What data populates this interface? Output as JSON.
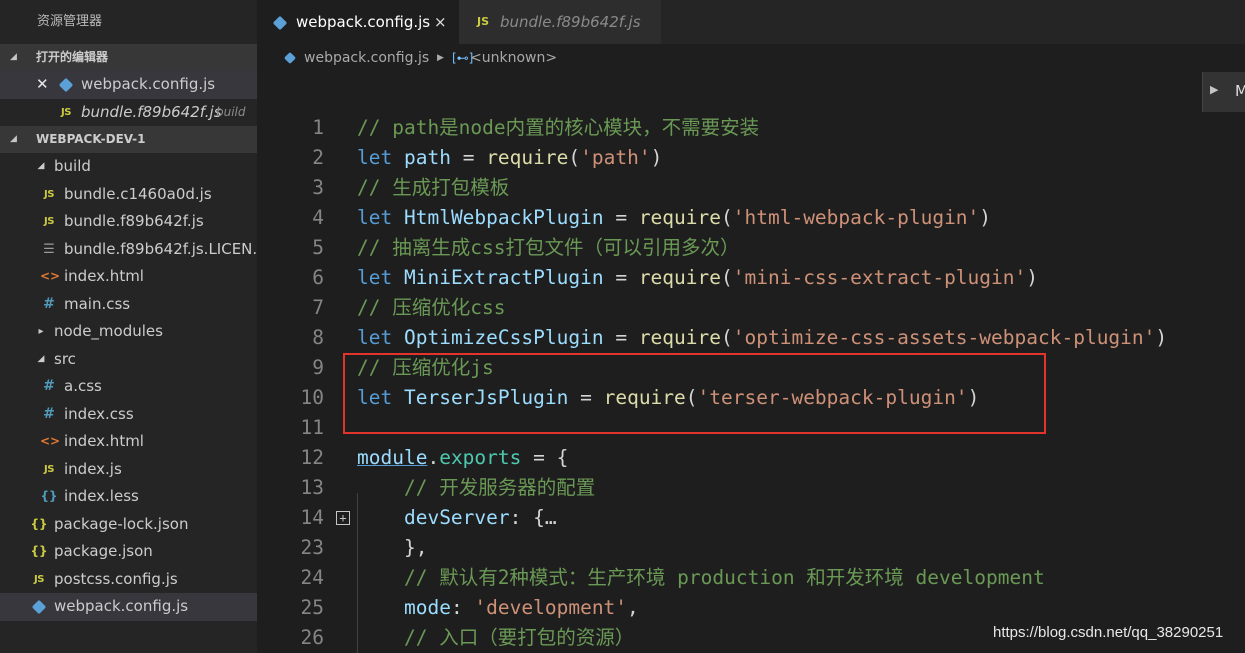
{
  "sidebar": {
    "title": "资源管理器",
    "open_editors": {
      "header": "打开的编辑器",
      "items": [
        {
          "label": "webpack.config.js",
          "icon": "webpack-cube-icon"
        },
        {
          "label": "bundle.f89b642f.js",
          "icon": "js-icon",
          "suffix": "build"
        }
      ]
    },
    "project": {
      "header": "WEBPACK-DEV-1",
      "tree": [
        {
          "label": "build",
          "type": "folder-open"
        },
        {
          "label": "bundle.c1460a0d.js",
          "icon": "JS"
        },
        {
          "label": "bundle.f89b642f.js",
          "icon": "JS"
        },
        {
          "label": "bundle.f89b642f.js.LICEN...",
          "icon": "≡"
        },
        {
          "label": "index.html",
          "icon": "<>"
        },
        {
          "label": "main.css",
          "icon": "#"
        },
        {
          "label": "node_modules",
          "type": "folder-closed"
        },
        {
          "label": "src",
          "type": "folder-open"
        },
        {
          "label": "a.css",
          "icon": "#"
        },
        {
          "label": "index.css",
          "icon": "#"
        },
        {
          "label": "index.html",
          "icon": "<>"
        },
        {
          "label": "index.js",
          "icon": "JS"
        },
        {
          "label": "index.less",
          "icon": "{}"
        },
        {
          "label": "package-lock.json",
          "icon": "{}"
        },
        {
          "label": "package.json",
          "icon": "{}"
        },
        {
          "label": "postcss.config.js",
          "icon": "JS"
        },
        {
          "label": "webpack.config.js",
          "icon": "webpack-cube-icon"
        }
      ]
    }
  },
  "tabs": [
    {
      "label": "webpack.config.js",
      "icon": "webpack-cube-icon",
      "close": "×"
    },
    {
      "label": "bundle.f89b642f.js",
      "icon": "JS"
    }
  ],
  "breadcrumb": {
    "file": "webpack.config.js",
    "symbol": "<unknown>"
  },
  "minimap_label": "M",
  "editor": {
    "lines": [
      {
        "num": "1",
        "text": "// path是node内置的核心模块，不需要安装"
      },
      {
        "num": "2",
        "text": "let path = require('path')"
      },
      {
        "num": "3",
        "text": "// 生成打包模板"
      },
      {
        "num": "4",
        "text": "let HtmlWebpackPlugin = require('html-webpack-plugin')"
      },
      {
        "num": "5",
        "text": "// 抽离生成css打包文件（可以引用多次）"
      },
      {
        "num": "6",
        "text": "let MiniExtractPlugin = require('mini-css-extract-plugin')"
      },
      {
        "num": "7",
        "text": "// 压缩优化css"
      },
      {
        "num": "8",
        "text": "let OptimizeCssPlugin = require('optimize-css-assets-webpack-plugin')"
      },
      {
        "num": "9",
        "text": "// 压缩优化js"
      },
      {
        "num": "10",
        "text": "let TerserJsPlugin = require('terser-webpack-plugin')"
      },
      {
        "num": "11",
        "text": ""
      },
      {
        "num": "12",
        "text": "module.exports = {"
      },
      {
        "num": "13",
        "text": "    // 开发服务器的配置"
      },
      {
        "num": "14",
        "text": "    devServer: {…"
      },
      {
        "num": "23",
        "text": "    },"
      },
      {
        "num": "24",
        "text": "    // 默认有2种模式：生产环境 production 和开发环境 development"
      },
      {
        "num": "25",
        "text": "    mode: 'development',"
      },
      {
        "num": "26",
        "text": "    // 入口（要打包的资源）"
      }
    ]
  },
  "watermark": "https://blog.csdn.net/qq_38290251",
  "colors": {
    "comment": "#6a9955",
    "keyword": "#569cd6",
    "string": "#ce9178",
    "function": "#dcdcaa",
    "variable": "#9cdcfe",
    "highlight_box": "#e0342d"
  }
}
